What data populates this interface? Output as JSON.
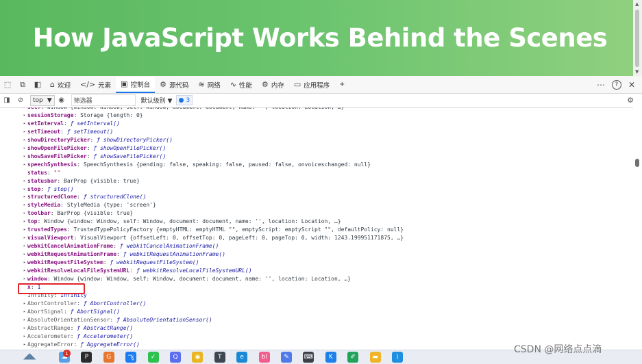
{
  "banner": {
    "title": "How JavaScript Works Behind the Scenes"
  },
  "devtools": {
    "tabs": [
      {
        "icon": "home-icon",
        "glyph": "⌂",
        "label": "欢迎",
        "active": false
      },
      {
        "icon": "code-icon",
        "glyph": "</>",
        "label": "元素",
        "active": false
      },
      {
        "icon": "console-icon",
        "glyph": "▣",
        "label": "控制台",
        "active": true
      },
      {
        "icon": "source-icon",
        "glyph": "⚙",
        "label": "源代码",
        "active": false
      },
      {
        "icon": "wifi-icon",
        "glyph": "≋",
        "label": "网络",
        "active": false
      },
      {
        "icon": "performance-icon",
        "glyph": "∿",
        "label": "性能",
        "active": false
      },
      {
        "icon": "memory-icon",
        "glyph": "⚙",
        "label": "内存",
        "active": false
      },
      {
        "icon": "application-icon",
        "glyph": "▭",
        "label": "应用程序",
        "active": false
      }
    ],
    "add_tab": "+",
    "more": "⋯",
    "help": "?",
    "close": "✕",
    "context": "top",
    "filter_placeholder": "筛选器",
    "levels": "默认级别 ▼",
    "issues_count": "3"
  },
  "console_rows": [
    {
      "tri": "▸",
      "key": "self",
      "sep": ": ",
      "val": "Window {window: Window, self: Window, document: document, name: '', location: Location, …}",
      "type": "v"
    },
    {
      "tri": "▸",
      "key": "sessionStorage",
      "sep": ": ",
      "val": "Storage {length: 0}",
      "type": "v"
    },
    {
      "tri": "▸",
      "key": "setInterval",
      "sep": ": ",
      "val": "ƒ setInterval()",
      "type": "fn"
    },
    {
      "tri": "▸",
      "key": "setTimeout",
      "sep": ": ",
      "val": "ƒ setTimeout()",
      "type": "fn"
    },
    {
      "tri": "▸",
      "key": "showDirectoryPicker",
      "sep": ": ",
      "val": "ƒ showDirectoryPicker()",
      "type": "fn"
    },
    {
      "tri": "▸",
      "key": "showOpenFilePicker",
      "sep": ": ",
      "val": "ƒ showOpenFilePicker()",
      "type": "fn"
    },
    {
      "tri": "▸",
      "key": "showSaveFilePicker",
      "sep": ": ",
      "val": "ƒ showSaveFilePicker()",
      "type": "fn"
    },
    {
      "tri": "▸",
      "key": "speechSynthesis",
      "sep": ": ",
      "val": "SpeechSynthesis {pending: false, speaking: false, paused: false, onvoiceschanged: null}",
      "type": "v"
    },
    {
      "tri": "",
      "key": "status",
      "sep": ": ",
      "val": "\"\"",
      "type": "str"
    },
    {
      "tri": "▸",
      "key": "statusbar",
      "sep": ": ",
      "val": "BarProp {visible: true}",
      "type": "v"
    },
    {
      "tri": "▸",
      "key": "stop",
      "sep": ": ",
      "val": "ƒ stop()",
      "type": "fn"
    },
    {
      "tri": "▸",
      "key": "structuredClone",
      "sep": ": ",
      "val": "ƒ structuredClone()",
      "type": "fn"
    },
    {
      "tri": "▸",
      "key": "styleMedia",
      "sep": ": ",
      "val": "StyleMedia {type: 'screen'}",
      "type": "v"
    },
    {
      "tri": "▸",
      "key": "toolbar",
      "sep": ": ",
      "val": "BarProp {visible: true}",
      "type": "v"
    },
    {
      "tri": "▸",
      "key": "top",
      "sep": ": ",
      "val": "Window {window: Window, self: Window, document: document, name: '', location: Location, …}",
      "type": "v"
    },
    {
      "tri": "▸",
      "key": "trustedTypes",
      "sep": ": ",
      "val": "TrustedTypePolicyFactory {emptyHTML: emptyHTML \"\", emptyScript: emptyScript \"\", defaultPolicy: null}",
      "type": "v"
    },
    {
      "tri": "▸",
      "key": "visualViewport",
      "sep": ": ",
      "val": "VisualViewport {offsetLeft: 0, offsetTop: 0, pageLeft: 0, pageTop: 0, width: 1243.199951171875, …}",
      "type": "v"
    },
    {
      "tri": "▸",
      "key": "webkitCancelAnimationFrame",
      "sep": ": ",
      "val": "ƒ webkitCancelAnimationFrame()",
      "type": "fn"
    },
    {
      "tri": "▸",
      "key": "webkitRequestAnimationFrame",
      "sep": ": ",
      "val": "ƒ webkitRequestAnimationFrame()",
      "type": "fn"
    },
    {
      "tri": "▸",
      "key": "webkitRequestFileSystem",
      "sep": ": ",
      "val": "ƒ webkitRequestFileSystem()",
      "type": "fn"
    },
    {
      "tri": "▸",
      "key": "webkitResolveLocalFileSystemURL",
      "sep": ": ",
      "val": "ƒ webkitResolveLocalFileSystemURL()",
      "type": "fn"
    },
    {
      "tri": "▸",
      "key": "window",
      "sep": ": ",
      "val": "Window {window: Window, self: Window, document: document, name: '', location: Location, …}",
      "type": "v"
    },
    {
      "tri": "",
      "key": "x",
      "sep": ": ",
      "val": "1",
      "type": "num"
    },
    {
      "tri": "",
      "key": "Infinity",
      "sep": ": ",
      "val": "Infinity",
      "type": "kw",
      "gray": true
    },
    {
      "tri": "▸",
      "key": "AbortController",
      "sep": ": ",
      "val": "ƒ AbortController()",
      "type": "fn",
      "gray": true
    },
    {
      "tri": "▸",
      "key": "AbortSignal",
      "sep": ": ",
      "val": "ƒ AbortSignal()",
      "type": "fn",
      "gray": true
    },
    {
      "tri": "▸",
      "key": "AbsoluteOrientationSensor",
      "sep": ": ",
      "val": "ƒ AbsoluteOrientationSensor()",
      "type": "fn",
      "gray": true
    },
    {
      "tri": "▸",
      "key": "AbstractRange",
      "sep": ": ",
      "val": "ƒ AbstractRange()",
      "type": "fn",
      "gray": true
    },
    {
      "tri": "▸",
      "key": "Accelerometer",
      "sep": ": ",
      "val": "ƒ Accelerometer()",
      "type": "fn",
      "gray": true
    },
    {
      "tri": "▸",
      "key": "AggregateError",
      "sep": ": ",
      "val": "ƒ AggregateError()",
      "type": "fn",
      "gray": true
    }
  ],
  "taskbar": {
    "badge": "1",
    "apps": [
      {
        "name": "cloud-app-icon",
        "color": "#5aa0e8",
        "glyph": "☁"
      },
      {
        "name": "pycharm-icon",
        "color": "#2b2b2b",
        "glyph": "P"
      },
      {
        "name": "office-icon",
        "color": "#e8772e",
        "glyph": "G"
      },
      {
        "name": "feishu-icon",
        "color": "#1c7cf2",
        "glyph": "飞"
      },
      {
        "name": "wechat-icon",
        "color": "#2dc24d",
        "glyph": "✓"
      },
      {
        "name": "qq-icon",
        "color": "#5c6ef0",
        "glyph": "Q"
      },
      {
        "name": "chrome-icon",
        "color": "#e9b520",
        "glyph": "◉"
      },
      {
        "name": "typora-icon",
        "color": "#3f4652",
        "glyph": "T"
      },
      {
        "name": "edge-icon",
        "color": "#1a8ad6",
        "glyph": "e"
      },
      {
        "name": "bili-icon",
        "color": "#f25d8e",
        "glyph": "bl"
      },
      {
        "name": "tool-icon",
        "color": "#4e7be8",
        "glyph": "✎"
      },
      {
        "name": "terminal-icon",
        "color": "#3b3f48",
        "glyph": "⌨"
      },
      {
        "name": "kugou-icon",
        "color": "#1c80e8",
        "glyph": "K"
      },
      {
        "name": "notebook-icon",
        "color": "#23a35a",
        "glyph": "✐"
      },
      {
        "name": "folder-icon",
        "color": "#f0b429",
        "glyph": "▬"
      },
      {
        "name": "vscode-icon",
        "color": "#1f8fe0",
        "glyph": "⟩"
      }
    ],
    "watermark": "CSDN @网络点点滴"
  }
}
